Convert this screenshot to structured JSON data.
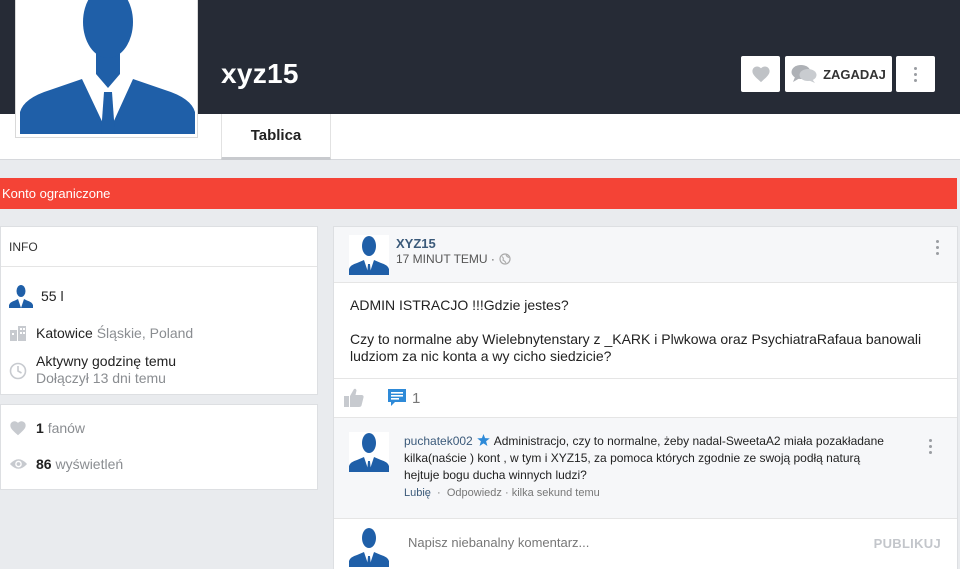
{
  "profile": {
    "username": "xyz15",
    "tab_wall": "Tablica",
    "ask_button": "ZAGADAJ"
  },
  "alert": {
    "text": "Konto ograniczone"
  },
  "info": {
    "header": "INFO",
    "age": "55 l",
    "city": "Katowice",
    "region": "Śląskie, Poland",
    "active": "Aktywny godzinę temu",
    "joined": "Dołączył 13 dni temu"
  },
  "stats": {
    "fans_count": "1",
    "fans_label": "fanów",
    "views_count": "86",
    "views_label": "wyświetleń"
  },
  "post": {
    "author": "XYZ15",
    "time": "17 MINUT TEMU ·",
    "line1": "ADMIN ISTRACJO !!!Gdzie jestes?",
    "line2": "Czy to normalne aby Wielebnytenstary z _KARK i Plwkowa oraz PsychiatraRafaua banowali ludziom za nic konta a wy cicho siedzicie?",
    "comment_count": "1"
  },
  "comment": {
    "author": "puchatek002",
    "text": "Administracjo, czy to normalne, żeby nadal-SweetaA2 miała pozakładane kilka(naście ) kont , w tym i XYZ15, za pomoca których zgodnie ze swoją podłą naturą hejtuje bogu ducha winnych ludzi?",
    "like": "Lubię",
    "sep1": "·",
    "reply": "Odpowiedz",
    "sep2": "·",
    "time": "kilka sekund temu"
  },
  "reply_box": {
    "placeholder": "Napisz niebanalny komentarz...",
    "publish": "PUBLIKUJ"
  },
  "colors": {
    "hero_bg": "#262b36",
    "alert": "#f44336",
    "link": "#3b5a7a",
    "avatar_blue": "#1f5fa8",
    "comment_icon": "#2e8ad8"
  },
  "icons": [
    "heart-icon",
    "chat-bubbles-icon",
    "more-vertical-icon",
    "user-avatar-icon",
    "building-icon",
    "clock-icon",
    "eye-icon",
    "thumb-up-icon",
    "comment-icon",
    "star-icon",
    "globe-icon"
  ]
}
